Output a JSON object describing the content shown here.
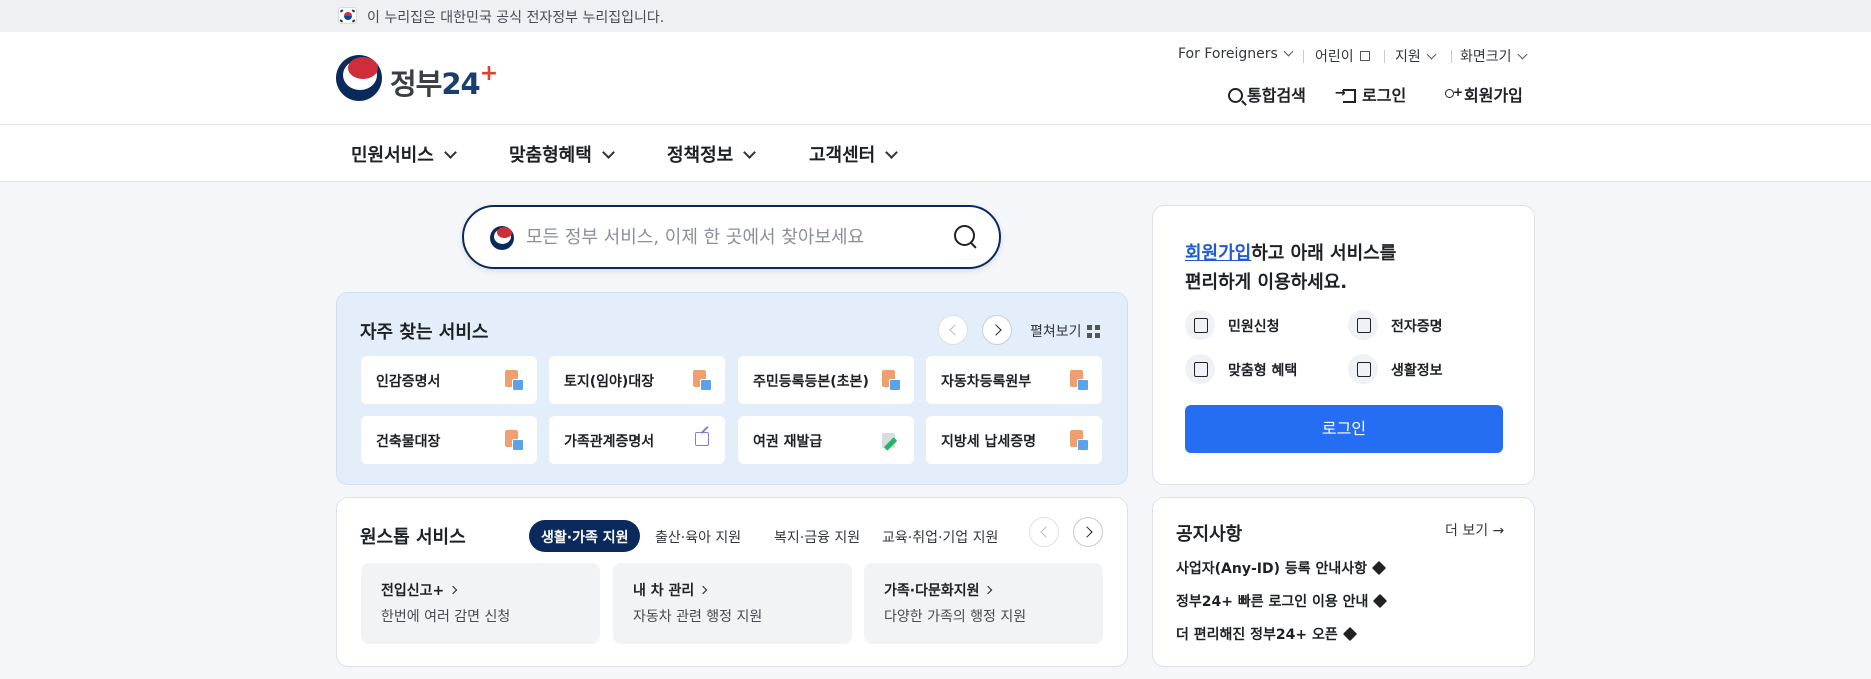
{
  "banner": {
    "text": "이 누리집은 대한민국 공식 전자정부 누리집입니다."
  },
  "logo": {
    "text_a": "정부",
    "text_b": "24",
    "text_c": "+"
  },
  "utility": {
    "foreigners": "For Foreigners",
    "kids": "어린이",
    "support": "지원",
    "screen_size": "화면크기"
  },
  "header_actions": {
    "search": "통합검색",
    "login": "로그인",
    "signup": "회원가입"
  },
  "gnb": [
    "민원서비스",
    "맞춤형혜택",
    "정책정보",
    "고객센터"
  ],
  "search": {
    "placeholder": "모든 정부 서비스, 이제 한 곳에서 찾아보세요"
  },
  "frequent": {
    "title": "자주 찾는 서비스",
    "expand": "펼쳐보기",
    "items": [
      "인감증명서",
      "토지(임야)대장",
      "주민등록등본(초본)",
      "자동차등록원부",
      "건축물대장",
      "가족관계증명서",
      "여권 재발급",
      "지방세 납세증명"
    ]
  },
  "onestop": {
    "title": "원스톱 서비스",
    "tabs": [
      "생활·가족 지원",
      "출산·육아 지원",
      "복지·금융 지원",
      "교육·취업·기업 지원"
    ],
    "cards": [
      {
        "title": "전입신고+",
        "desc": "한번에 여러 감면 신청"
      },
      {
        "title": "내 차 관리",
        "desc": "자동차 관련 행정 지원"
      },
      {
        "title": "가족·다문화지원",
        "desc": "다양한 가족의 행정 지원"
      }
    ]
  },
  "login_panel": {
    "link": "회원가입",
    "line1_rest": "하고 아래 서비스를",
    "line2": "편리하게 이용하세요.",
    "quick": [
      "민원신청",
      "전자증명",
      "맞춤형 혜택",
      "생활정보"
    ],
    "button": "로그인"
  },
  "notice": {
    "title": "공지사항",
    "more": "더 보기 →",
    "items": [
      "사업자(Any-ID) 등록 안내사항",
      "정부24+ 빠른 로그인 이용 안내",
      "더 편리해진 정부24+ 오픈"
    ]
  },
  "colors": {
    "primary": "#256ef4",
    "navy": "#0b2a5c",
    "freq_bg": "#e4eefa"
  }
}
